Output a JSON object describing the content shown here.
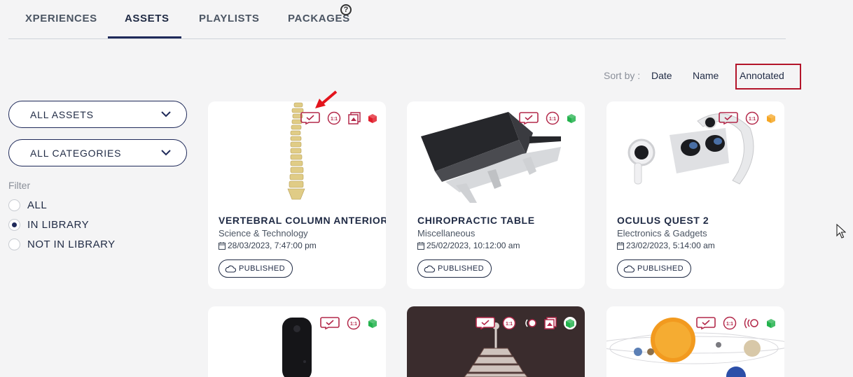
{
  "tabs": [
    {
      "label": "XPERIENCES"
    },
    {
      "label": "ASSETS"
    },
    {
      "label": "PLAYLISTS"
    },
    {
      "label": "PACKAGES"
    }
  ],
  "active_tab": "ASSETS",
  "sort": {
    "label": "Sort by :",
    "options": [
      "Date",
      "Name",
      "Annotated"
    ],
    "selected": "Annotated"
  },
  "filters": {
    "assets_dropdown": "ALL ASSETS",
    "categories_dropdown": "ALL CATEGORIES",
    "title": "Filter",
    "options": [
      "ALL",
      "IN LIBRARY",
      "NOT IN LIBRARY"
    ],
    "selected": "IN LIBRARY"
  },
  "cards": [
    {
      "title": "VERTEBRAL COLUMN ANTERIOR",
      "category": "Science & Technology",
      "date": "28/03/2023, 7:47:00 pm",
      "status": "PUBLISHED",
      "cube_color": "#e11d2a"
    },
    {
      "title": "CHIROPRACTIC TABLE",
      "category": "Miscellaneous",
      "date": "25/02/2023, 10:12:00 am",
      "status": "PUBLISHED",
      "cube_color": "#22b24c"
    },
    {
      "title": "OCULUS QUEST 2",
      "category": "Electronics & Gadgets",
      "date": "23/02/2023, 5:14:00 am",
      "status": "PUBLISHED",
      "cube_color": "#f5a623"
    }
  ],
  "icon_ratio_label": "1:1",
  "colors": {
    "accent": "#1f2a5a",
    "icon": "#b3294a",
    "highlight": "#b3142a"
  }
}
